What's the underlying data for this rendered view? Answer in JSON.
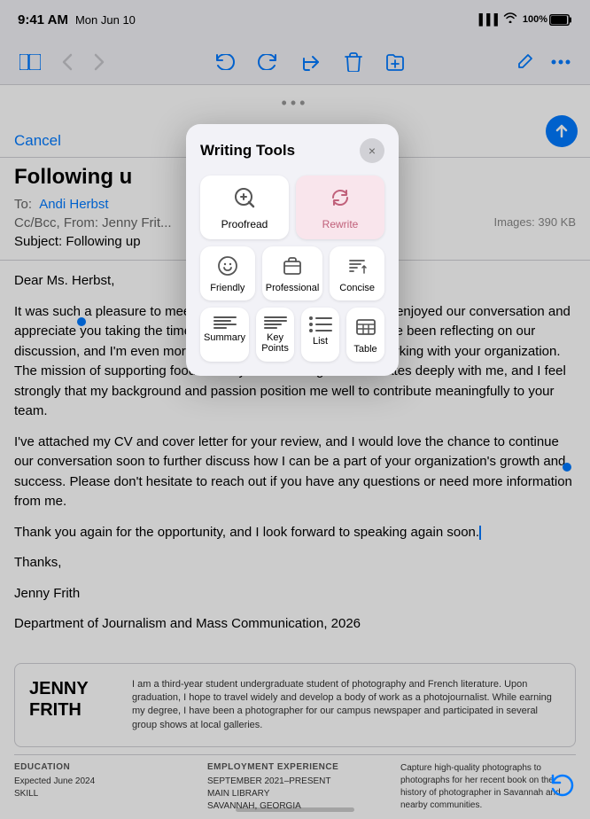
{
  "statusBar": {
    "time": "9:41 AM",
    "date": "Mon Jun 10",
    "battery": "100%"
  },
  "toolbar": {
    "sidebarIcon": "☰",
    "backIcon": "‹",
    "forwardIcon": "›",
    "undoIcon": "↩",
    "redoIcon": "↩",
    "forwardMailIcon": "↪",
    "deleteIcon": "🗑",
    "folderIcon": "⬜",
    "composeIcon": "✏",
    "moreIcon": "⋯"
  },
  "email": {
    "cancelLabel": "Cancel",
    "subject": "Following u",
    "toLabel": "To:",
    "toName": "Andi Herbst",
    "ccLabel": "Cc/Bcc, From: Jenny Frit...",
    "subjectField": "Subject: Following up",
    "imagesInfo": "Images: 390 KB",
    "greeting": "Dear Ms. Herbst,",
    "paragraph1": "It was such a pleasure to meet you and your team at the event. I enjoyed our conversation and appreciate you taking the time to share more about your work. I've been reflecting on our discussion, and I'm even more excited about the possibility of working with your organization. The mission of supporting food security is something that resonates deeply with me, and I feel strongly that my background and passion position me well to contribute meaningfully to your team.",
    "paragraph2": "I've attached my CV and cover letter for your review, and I would love the chance to continue our conversation soon to further discuss how I can be a part of your organization's growth and success. Please don't hesitate to reach out if you have any questions or need more information from me.",
    "closing": "Thank you again for the opportunity, and I look forward to speaking again soon.",
    "signoff": "Thanks,",
    "name": "Jenny Frith",
    "department": "Department of Journalism and Mass Communication, 2026"
  },
  "resume": {
    "firstName": "JENNY",
    "lastName": "FRITH",
    "bio": "I am a third-year student undergraduate student of photography and French literature. Upon graduation, I hope to travel widely and develop a body of work as a photojournalist. While earning my degree, I have been a photographer for our campus newspaper and participated in several group shows at local galleries.",
    "educationTitle": "EDUCATION",
    "educationContent": "Expected June 2024\nSKILL",
    "employmentTitle": "EMPLOYMENT EXPERIENCE",
    "employmentContent": "SEPTEMBER 2021–PRESENT\nMAIN LIBRARY\nSAVANNAH, GEORGIA",
    "employmentDetail": "Capture high-quality photographs to photographs for her recent book on the history of photographer in Savannah and nearby communities."
  },
  "writingTools": {
    "title": "Writing Tools",
    "closeLabel": "×",
    "proofreadLabel": "Proofread",
    "rewriteLabel": "Rewrite",
    "friendlyLabel": "Friendly",
    "professionalLabel": "Professional",
    "conciseLabel": "Concise",
    "summaryLabel": "Summary",
    "keyPointsLabel": "Key Points",
    "listLabel": "List",
    "tableLabel": "Table"
  }
}
